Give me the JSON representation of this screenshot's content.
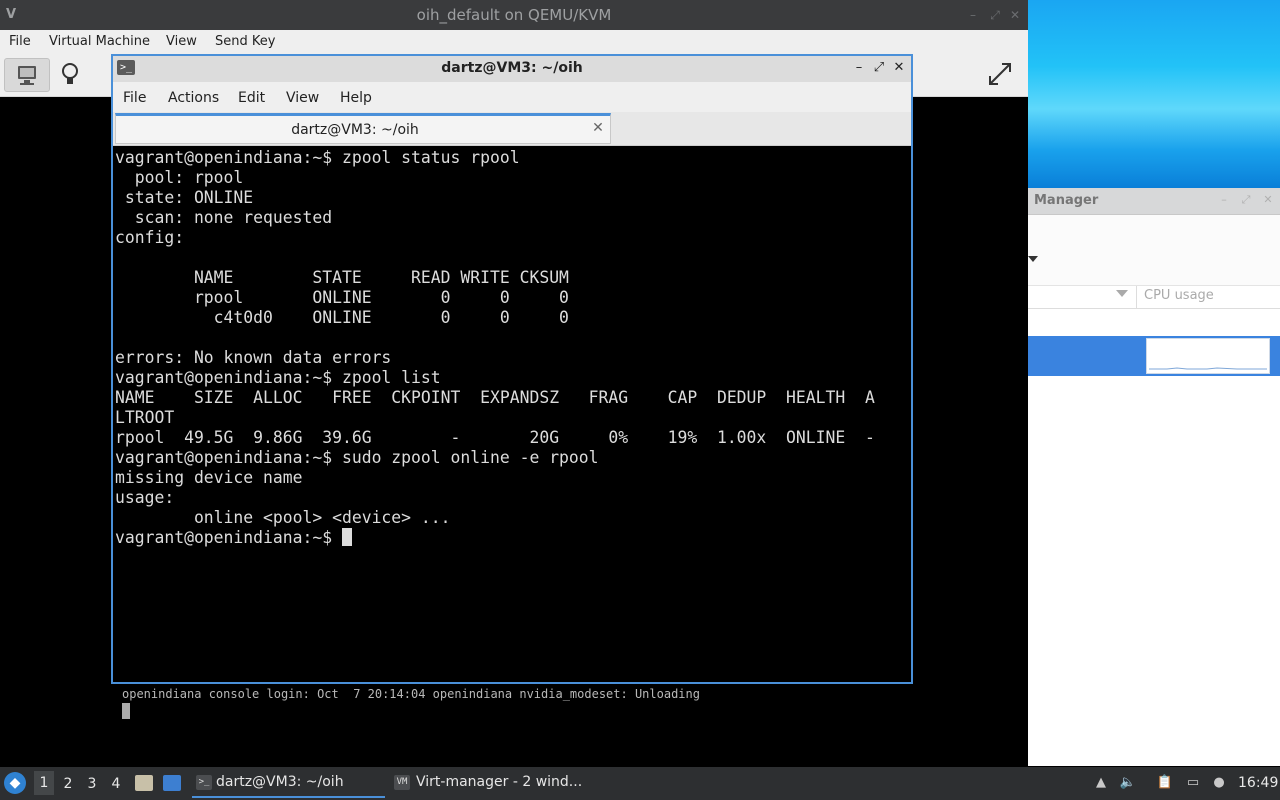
{
  "qemu_window": {
    "title": "oih_default on QEMU/KVM",
    "menu": [
      "File",
      "Virtual Machine",
      "View",
      "Send Key"
    ],
    "console_message": "openindiana console login: Oct  7 20:14:04 openindiana nvidia_modeset: Unloading"
  },
  "terminal": {
    "title": "dartz@VM3: ~/oih",
    "menu": [
      "File",
      "Actions",
      "Edit",
      "View",
      "Help"
    ],
    "tab_label": "dartz@VM3: ~/oih",
    "lines": [
      "vagrant@openindiana:~$ zpool status rpool",
      "  pool: rpool",
      " state: ONLINE",
      "  scan: none requested",
      "config:",
      "",
      "        NAME        STATE     READ WRITE CKSUM",
      "        rpool       ONLINE       0     0     0",
      "          c4t0d0    ONLINE       0     0     0",
      "",
      "errors: No known data errors",
      "vagrant@openindiana:~$ zpool list",
      "NAME    SIZE  ALLOC   FREE  CKPOINT  EXPANDSZ   FRAG    CAP  DEDUP  HEALTH  A",
      "LTROOT",
      "rpool  49.5G  9.86G  39.6G        -       20G     0%    19%  1.00x  ONLINE  -",
      "vagrant@openindiana:~$ sudo zpool online -e rpool",
      "missing device name",
      "usage:",
      "        online <pool> <device> ..."
    ],
    "prompt": "vagrant@openindiana:~$ "
  },
  "virt_manager": {
    "title": "Manager",
    "column_cpu": "CPU usage"
  },
  "taskbar": {
    "workspaces": [
      "1",
      "2",
      "3",
      "4"
    ],
    "tasks": [
      {
        "label": "dartz@VM3: ~/oih",
        "icon": "terminal-icon"
      },
      {
        "label": "Virt-manager - 2 wind...",
        "icon": "virt-manager-icon"
      }
    ],
    "clock": "16:49"
  },
  "colors": {
    "accent": "#4a90d9",
    "selection": "#3a83df",
    "taskbar": "#2d2f31"
  }
}
